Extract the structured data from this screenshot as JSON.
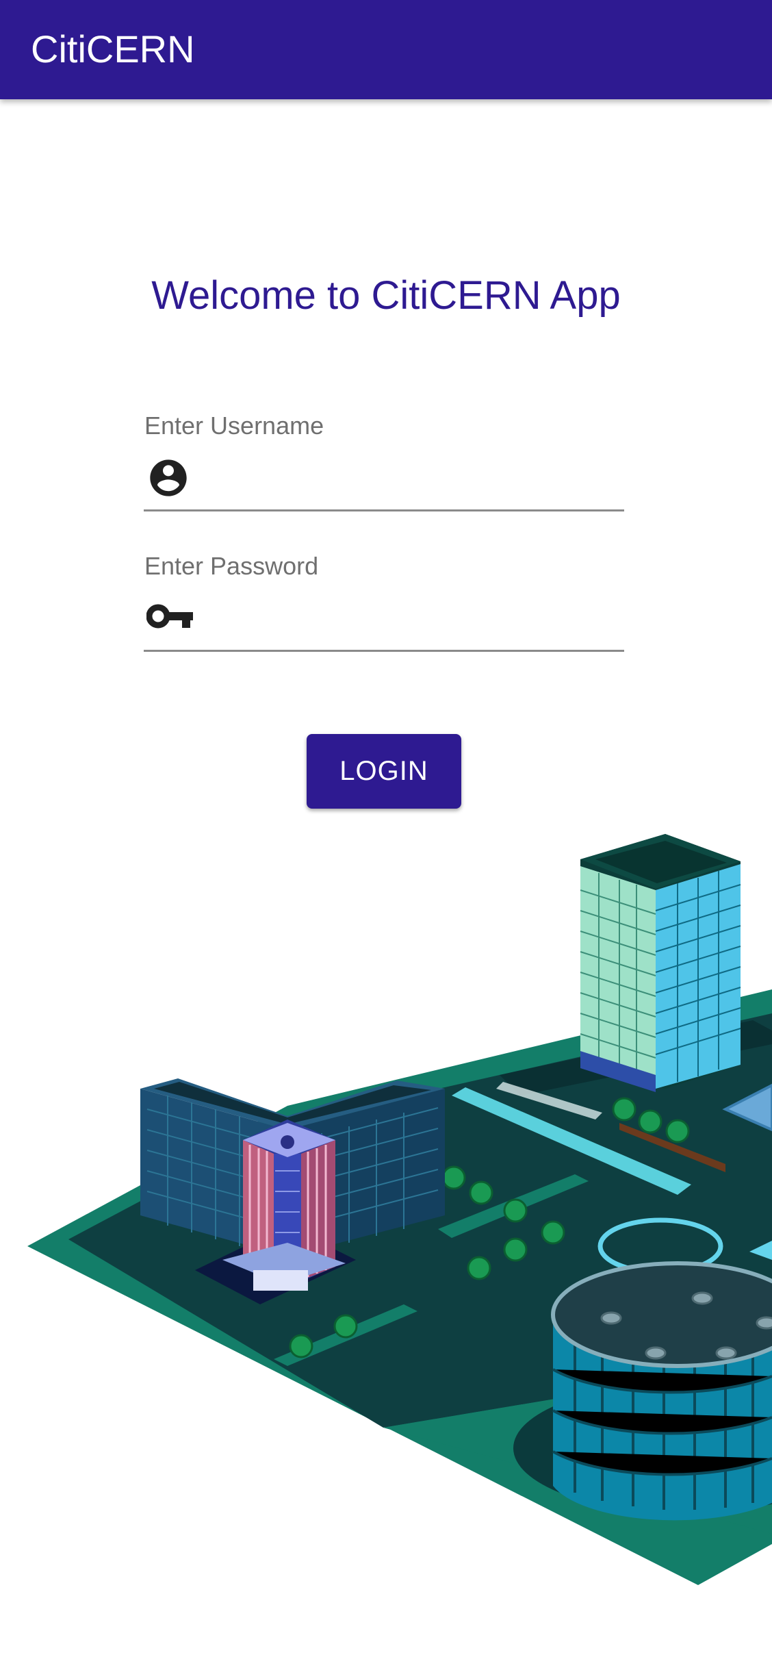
{
  "app_bar": {
    "title": "CitiCERN"
  },
  "main": {
    "welcome_text": "Welcome to CitiCERN App",
    "username": {
      "label": "Enter Username",
      "value": "",
      "icon": "account-circle-icon"
    },
    "password": {
      "label": "Enter Password",
      "value": "",
      "icon": "key-icon"
    },
    "login_label": "LOGIN"
  },
  "colors": {
    "primary": "#2e1a91",
    "label_gray": "#6f6f6f",
    "icon_dark": "#212121",
    "ground_dark": "#0e3f41",
    "ground_green": "#137e69",
    "tower_cyan": "#4fc4e8"
  }
}
